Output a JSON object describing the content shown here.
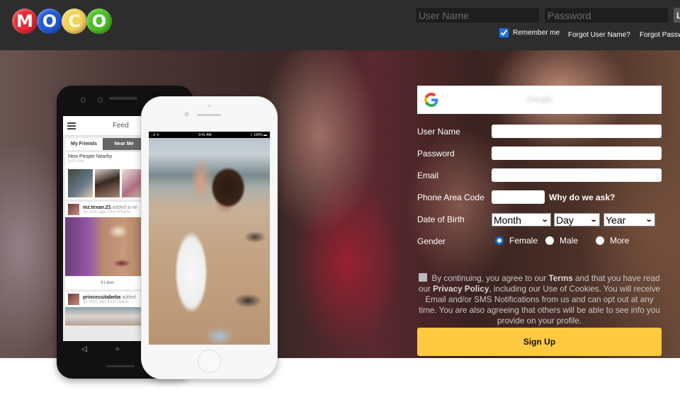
{
  "header": {
    "logo_letters": [
      "M",
      "O",
      "C",
      "O"
    ],
    "login": {
      "username_placeholder": "User Name",
      "password_placeholder": "Password",
      "login_button_label": "L",
      "remember_me_label": "Remember me",
      "remember_me_checked": true,
      "forgot_username_link": "Forgot User Name?",
      "forgot_password_link": "Forgot Passw"
    }
  },
  "hero": {
    "android_phone": {
      "title": "Feed",
      "tabs": [
        "My Friends",
        "Near Me"
      ],
      "active_tab": "Near Me",
      "nearby_title": "New People Nearby",
      "nearby_time": "just now",
      "posts": [
        {
          "user": "mz.texan.21",
          "action": "added a ne",
          "meta": "38 mins ago from Wharto",
          "likes": "4 Likes"
        },
        {
          "user": "princessitabeba",
          "action": "added",
          "meta": "45 mins ago from Dallas"
        }
      ],
      "nav_back": "◁",
      "nav_home": "○"
    },
    "iphone": {
      "status_time": "9:41 AM",
      "status_battery": "100%",
      "status_signal": "..ıl ᯤ"
    }
  },
  "signup": {
    "google_button_label": "Google",
    "fields": {
      "username_label": "User Name",
      "password_label": "Password",
      "email_label": "Email",
      "phone_area_label": "Phone Area Code",
      "why_link": "Why do we ask?",
      "dob_label": "Date of Birth",
      "month_selected": "Month",
      "day_selected": "Day",
      "year_selected": "Year",
      "gender_label": "Gender",
      "gender_options": [
        "Female",
        "Male",
        "More"
      ],
      "gender_selected": "Female"
    },
    "terms": {
      "part1": "By continuing, you agree to our ",
      "terms_link": "Terms",
      "part2": " and that you have read our ",
      "privacy_link": "Privacy Policy",
      "part3": ", including our Use of Cookies. You will receive Email and/or SMS Notifications from us and can opt out at any time. You are also agreeing that others will be able to see info you provide on your profile.",
      "checked": false
    },
    "signup_button_label": "Sign Up"
  },
  "colors": {
    "header_bg": "#2d2d2d",
    "signup_button": "#ffca3f",
    "radio_accent": "#0b6bd6"
  }
}
